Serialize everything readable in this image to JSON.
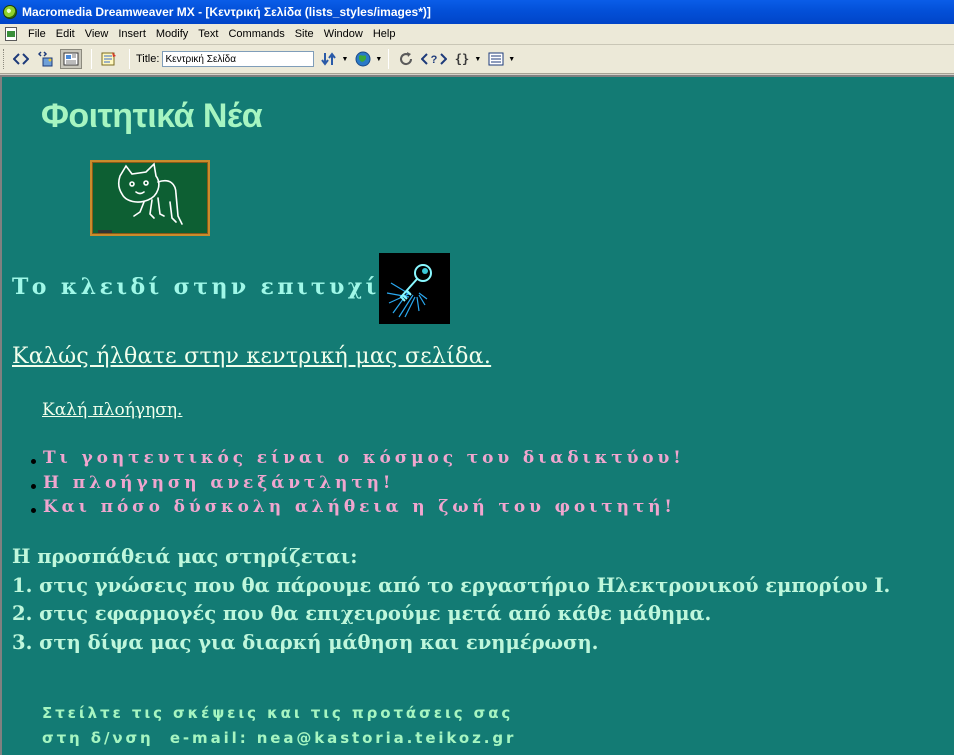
{
  "window": {
    "title": "Macromedia Dreamweaver MX - [Κεντρική Σελίδα (lists_styles/images*)]"
  },
  "menu": {
    "items": [
      "File",
      "Edit",
      "View",
      "Insert",
      "Modify",
      "Text",
      "Commands",
      "Site",
      "Window",
      "Help"
    ]
  },
  "toolbar": {
    "title_label": "Title:",
    "title_value": "Κεντρική Σελίδα",
    "icons": [
      "code-view-icon",
      "split-view-icon",
      "design-view-icon",
      "live-data-icon",
      "file-management-icon",
      "preview-globe-icon",
      "refresh-icon",
      "reference-icon",
      "code-navigation-icon",
      "view-options-icon"
    ]
  },
  "page": {
    "heading": "Φοιτητικά Νέα",
    "key_heading": "Το κλειδί στην επιτυχία!",
    "welcome": "Καλώς ήλθατε στην κεντρική μας σελίδα.",
    "browse": "Καλή πλοήγηση.",
    "bullets": [
      "Τι γοητευτικός είναι ο κόσμος του διαδικτύου!",
      "Η πλοήγηση ανεξάντλητη!",
      "Και πόσο δύσκολη αλήθεια η ζωή του φοιτητή!"
    ],
    "effort": [
      "Η προσπάθειά μας στηρίζεται:",
      "1. στις γνώσεις που θα πάρουμε από το εργαστήριο Ηλεκτρονικού εμπορίου Ι.",
      "2. στις εφαρμογές που θα επιχειρούμε μετά από κάθε μάθημα.",
      "3. στη δίψα μας για διαρκή μάθηση και ενημέρωση."
    ],
    "contact": [
      "Στείλτε τις σκέψεις και τις προτάσεις σας",
      "στη δ/νση  e-mail: nea@kastoria.teikoz.gr"
    ]
  },
  "colors": {
    "page_background": "#137b74",
    "heading": "#a6f5c1",
    "key_heading": "#a0f8e8",
    "bullets": "#f0a6cf",
    "effort": "#bff7dc",
    "titlebar": "#0350d8"
  }
}
